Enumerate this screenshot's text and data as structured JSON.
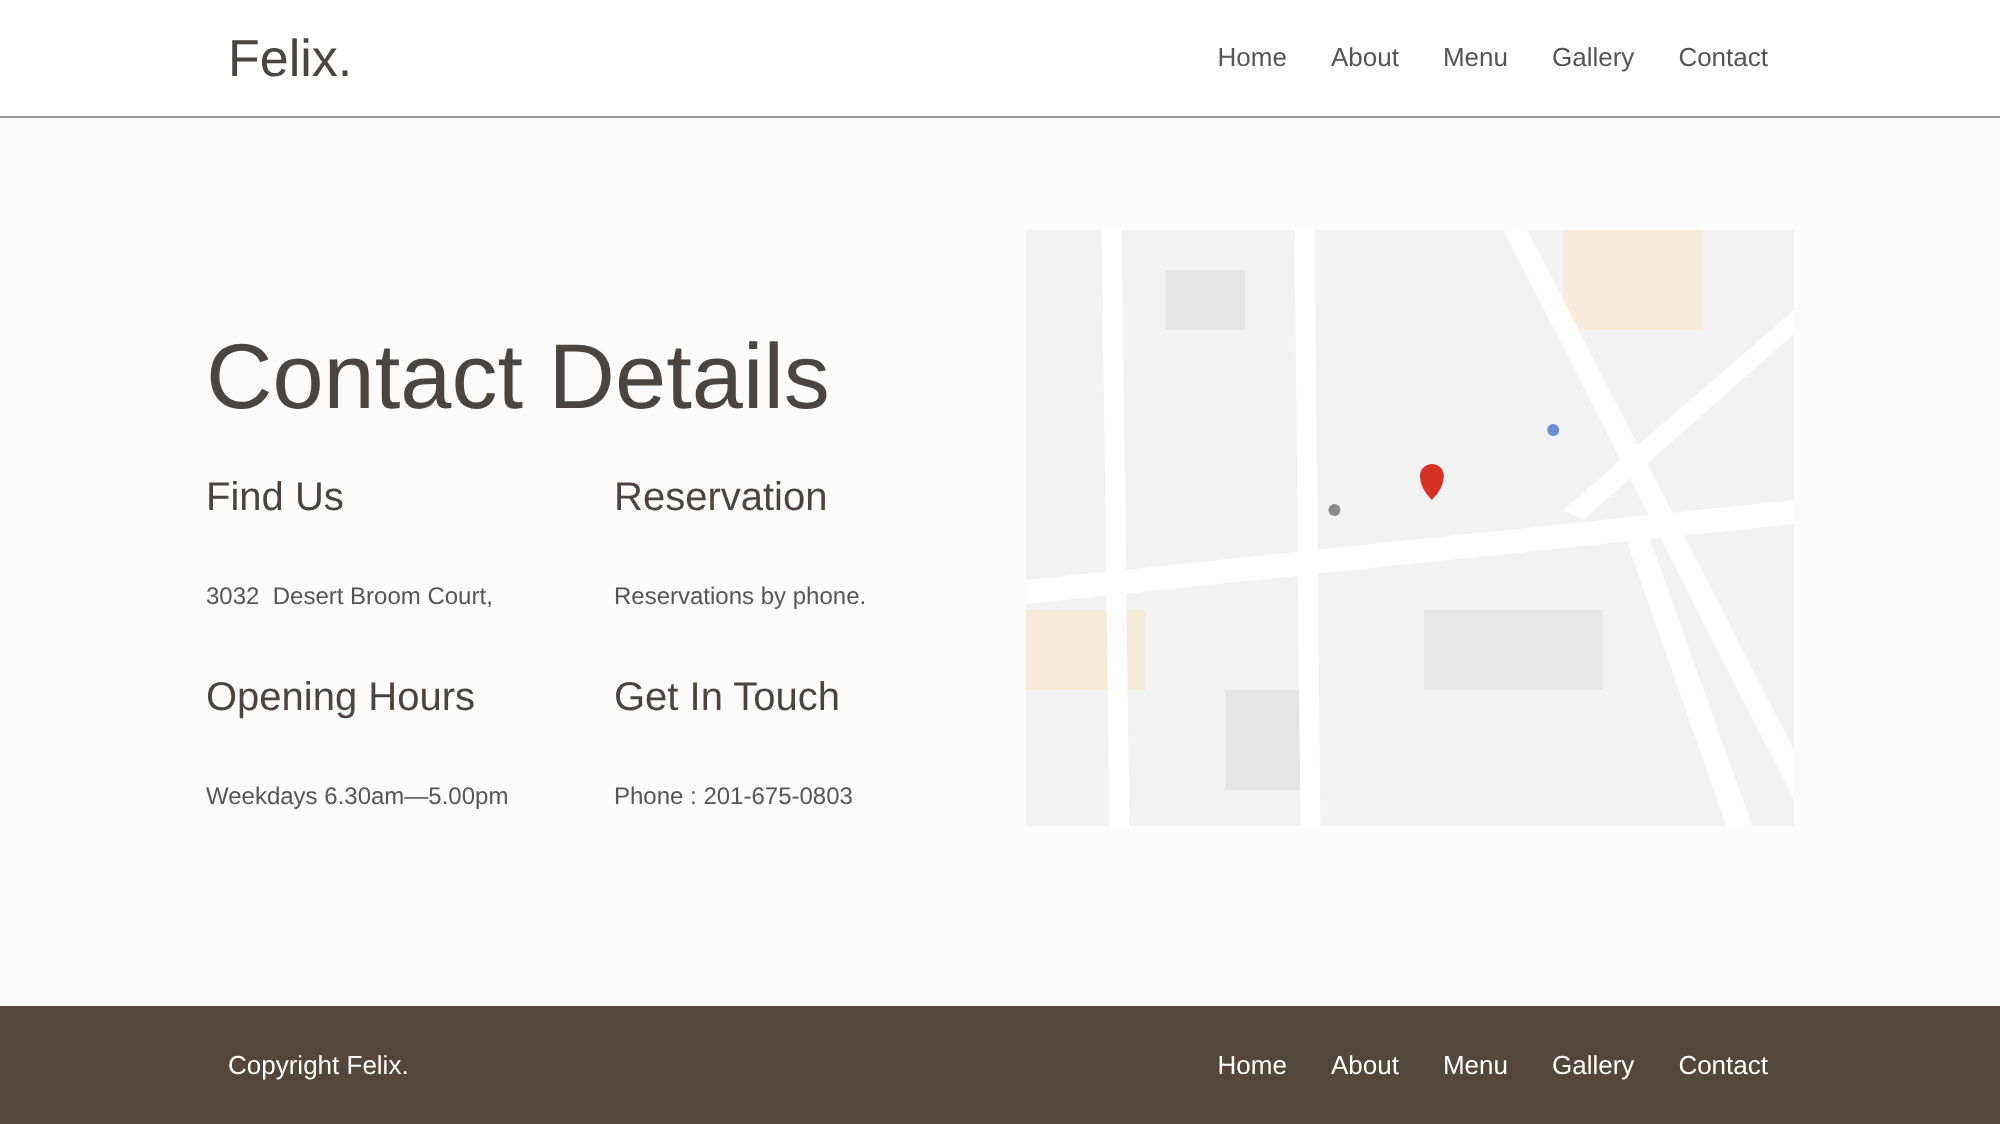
{
  "header": {
    "logo": "Felix.",
    "nav": [
      "Home",
      "About",
      "Menu",
      "Gallery",
      "Contact"
    ]
  },
  "contact": {
    "title": "Contact Details",
    "sections": [
      {
        "heading": "Find Us",
        "text": "3032  Desert Broom Court,"
      },
      {
        "heading": "Reservation",
        "text": "Reservations by phone."
      },
      {
        "heading": "Opening Hours",
        "text": "Weekdays 6.30am—5.00pm"
      },
      {
        "heading": "Get In Touch",
        "text": "Phone : 201-675-0803"
      }
    ]
  },
  "footer": {
    "copyright": "Copyright Felix.",
    "nav": [
      "Home",
      "About",
      "Menu",
      "Gallery",
      "Contact"
    ]
  }
}
